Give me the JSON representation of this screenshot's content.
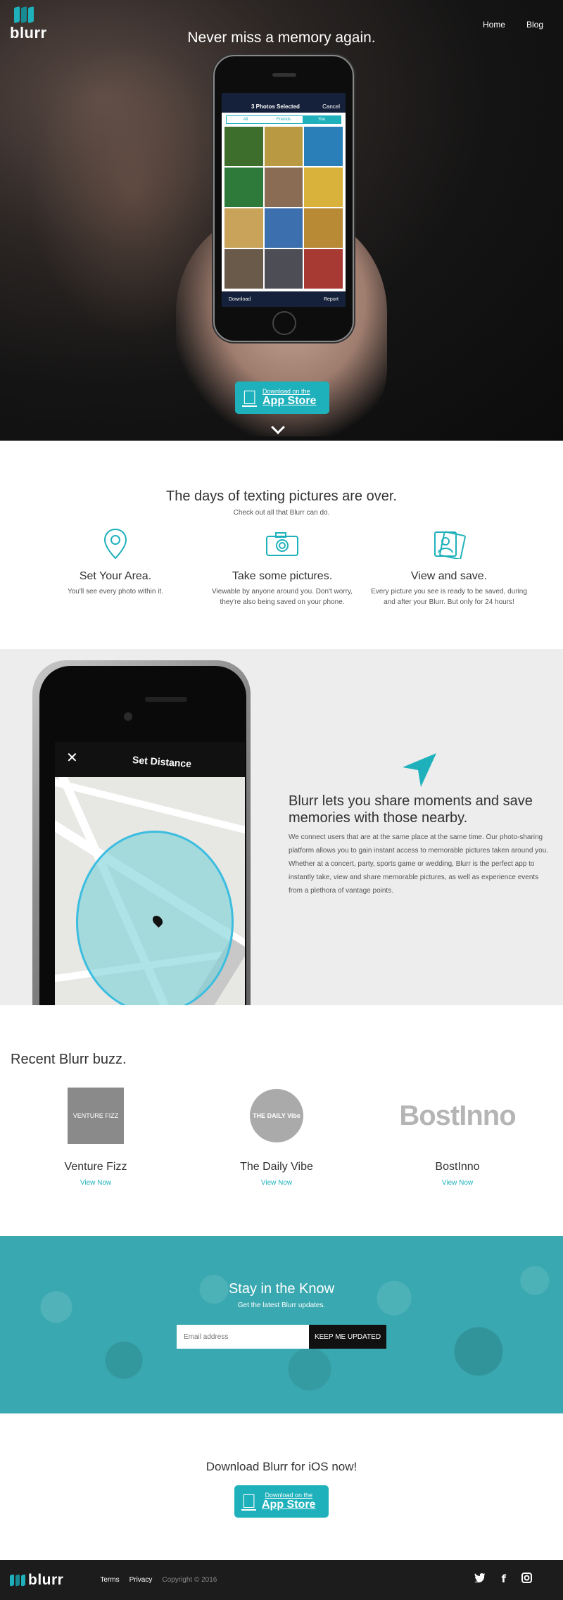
{
  "brand": {
    "name": "blurr",
    "accent": "#1fb1bb"
  },
  "nav": {
    "home": "Home",
    "blog": "Blog"
  },
  "hero": {
    "title": "Never miss a memory again.",
    "phone": {
      "header": "3 Photos Selected",
      "cancel": "Cancel",
      "tabs": [
        "All",
        "Friends",
        "You"
      ],
      "download": "Download",
      "report": "Report"
    },
    "appstore": {
      "line1": "Download on the",
      "line2": "App Store"
    }
  },
  "features": {
    "title": "The days of texting pictures are over.",
    "subtitle": "Check out all that Blurr can do.",
    "items": [
      {
        "icon": "location-pin-icon",
        "title": "Set Your Area.",
        "text": "You'll see every photo within it."
      },
      {
        "icon": "camera-icon",
        "title": "Take some pictures.",
        "text": "Viewable by anyone around you. Don't worry, they're also being saved on your phone."
      },
      {
        "icon": "photos-icon",
        "title": "View and save.",
        "text": "Every picture you see is ready to be saved, during and after your Blurr. But only for 24 hours!"
      }
    ]
  },
  "share": {
    "phone_title": "Set Distance",
    "heading": "Blurr lets you share moments and save memories with those nearby.",
    "body": "We connect users that are at the same place at the same time. Our photo-sharing platform allows you to gain instant access to memorable pictures taken around you. Whether at a concert, party, sports game or wedding, Blurr is the perfect app to instantly take, view and share memorable pictures, as well as experience events from a plethora of vantage points."
  },
  "buzz": {
    "title": "Recent Blurr buzz.",
    "items": [
      {
        "logo_text": "VENTURE FIZZ",
        "name": "Venture Fizz",
        "link": "View Now"
      },
      {
        "logo_text": "THE DAILY Vibe",
        "name": "The Daily Vibe",
        "link": "View Now"
      },
      {
        "logo_text": "BostInno",
        "name": "BostInno",
        "link": "View Now"
      }
    ]
  },
  "newsletter": {
    "title": "Stay in the Know",
    "subtitle": "Get the latest Blurr updates.",
    "placeholder": "Email address",
    "button": "KEEP ME UPDATED"
  },
  "download": {
    "title": "Download Blurr for iOS now!",
    "appstore": {
      "line1": "Download on the",
      "line2": "App Store"
    }
  },
  "footer": {
    "terms": "Terms",
    "privacy": "Privacy",
    "copyright": "Copyright © 2016",
    "social": [
      "twitter-icon",
      "facebook-icon",
      "instagram-icon"
    ]
  }
}
